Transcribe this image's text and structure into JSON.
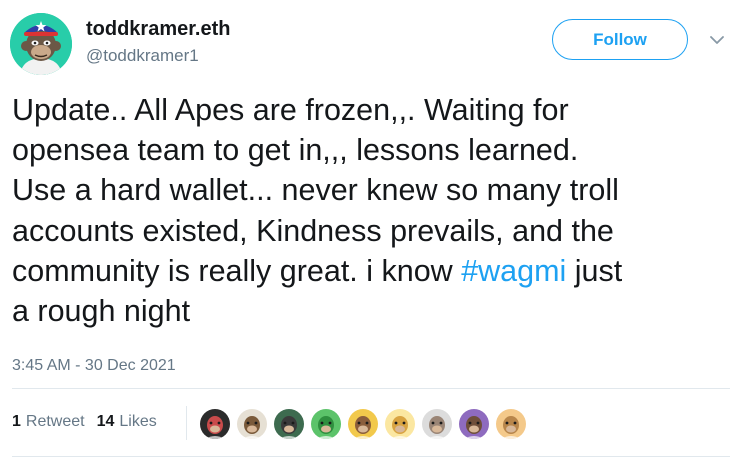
{
  "tweet": {
    "display_name": "toddkramer.eth",
    "handle": "@toddkramer1",
    "follow_label": "Follow",
    "text_lines": {
      "l1": "Update.. All Apes are frozen,,. Waiting for",
      "l2": "opensea team to get in,,, lessons learned.",
      "l3": "Use a hard wallet... never knew so many troll",
      "l4": "accounts existed, Kindness prevails, and the",
      "l5_before": "community is really great. i know ",
      "l5_hashtag": "#wagmi",
      "l5_after": " just",
      "l6": "a rough night"
    },
    "timestamp": "3:45 AM - 30 Dec 2021",
    "stats": {
      "retweets_count": "1",
      "retweets_label": "Retweet",
      "likes_count": "14",
      "likes_label": "Likes"
    }
  },
  "icons": {
    "avatar": "ape-avatar-icon",
    "menu": "chevron-down-icon"
  },
  "colors": {
    "accent": "#1da1f2",
    "text": "#14171a",
    "secondary_text": "#657786",
    "divider": "#e1e8ed",
    "avatar_bg": "#28cda9"
  },
  "likers": [
    {
      "name": "liker-avatar-1",
      "bg": "#2b2b2b",
      "face": "#c94b4b"
    },
    {
      "name": "liker-avatar-2",
      "bg": "#e6e0d4",
      "face": "#7a5a3a"
    },
    {
      "name": "liker-avatar-3",
      "bg": "#3d6b4f",
      "face": "#3a3a3a"
    },
    {
      "name": "liker-avatar-4",
      "bg": "#5cc36a",
      "face": "#2f8f3f"
    },
    {
      "name": "liker-avatar-5",
      "bg": "#f2c94c",
      "face": "#8b5e3c"
    },
    {
      "name": "liker-avatar-6",
      "bg": "#fbe7a1",
      "face": "#d9a441"
    },
    {
      "name": "liker-avatar-7",
      "bg": "#dcdcdc",
      "face": "#9a8576"
    },
    {
      "name": "liker-avatar-8",
      "bg": "#8e6bbf",
      "face": "#6f4f3a"
    },
    {
      "name": "liker-avatar-9",
      "bg": "#f4c98a",
      "face": "#b8864b"
    }
  ]
}
